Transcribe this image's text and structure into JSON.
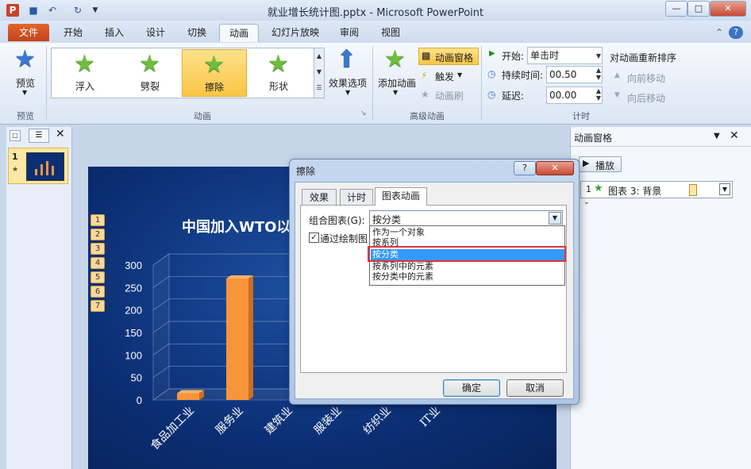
{
  "window": {
    "title": "就业增长统计图.pptx - Microsoft PowerPoint"
  },
  "tabs": [
    "文件",
    "开始",
    "插入",
    "设计",
    "切换",
    "动画",
    "幻灯片放映",
    "审阅",
    "视图"
  ],
  "ribbon": {
    "preview_group": {
      "button": "预览",
      "label": "预览"
    },
    "animation_gallery": {
      "items": [
        "浮入",
        "劈裂",
        "擦除",
        "形状"
      ],
      "selected": "擦除",
      "effect_options": "效果选项",
      "label": "动画"
    },
    "advanced": {
      "add_animation": "添加动画",
      "animation_pane": "动画窗格",
      "trigger": "触发",
      "painter": "动画刷",
      "label": "高级动画"
    },
    "timing": {
      "start_label": "开始:",
      "start_value": "单击时",
      "duration_label": "持续时间:",
      "duration_value": "00.50",
      "delay_label": "延迟:",
      "delay_value": "00.00",
      "reorder_title": "对动画重新排序",
      "move_earlier": "向前移动",
      "move_later": "向后移动",
      "label": "计时"
    }
  },
  "left_pane": {
    "slide_number": "1"
  },
  "slide": {
    "chart_data": {
      "type": "bar",
      "title": "中国加入WTO以后",
      "categories": [
        "食品加工业",
        "服务业",
        "建筑业",
        "服装业",
        "纺织业",
        "IT业"
      ],
      "values": [
        15,
        270,
        0,
        0,
        0,
        0
      ],
      "ylim": [
        0,
        300
      ],
      "yticks": [
        0,
        50,
        100,
        150,
        200,
        250,
        300
      ],
      "xlabel": "",
      "ylabel": ""
    },
    "tags": [
      "1",
      "2",
      "3",
      "4",
      "5",
      "6",
      "7"
    ]
  },
  "animation_pane": {
    "title": "动画窗格",
    "play_button": "播放",
    "item": {
      "index": "1",
      "label": "图表 3: 背景"
    }
  },
  "dialog": {
    "title": "擦除",
    "tabs": [
      "效果",
      "计时",
      "图表动画"
    ],
    "active_tab": "图表动画",
    "group_label": "组合图表(G):",
    "group_value": "按分类",
    "checkbox_label": "通过绘制图",
    "options": [
      "作为一个对象",
      "按系列",
      "按分类",
      "按系列中的元素",
      "按分类中的元素"
    ],
    "highlighted": "按分类",
    "ok": "确定",
    "cancel": "取消"
  },
  "colors": {
    "accent_file": "#d9522a",
    "bar_color": "#f7953b",
    "slide_bg": "#0b2f74",
    "highlight": "#e6333a"
  }
}
